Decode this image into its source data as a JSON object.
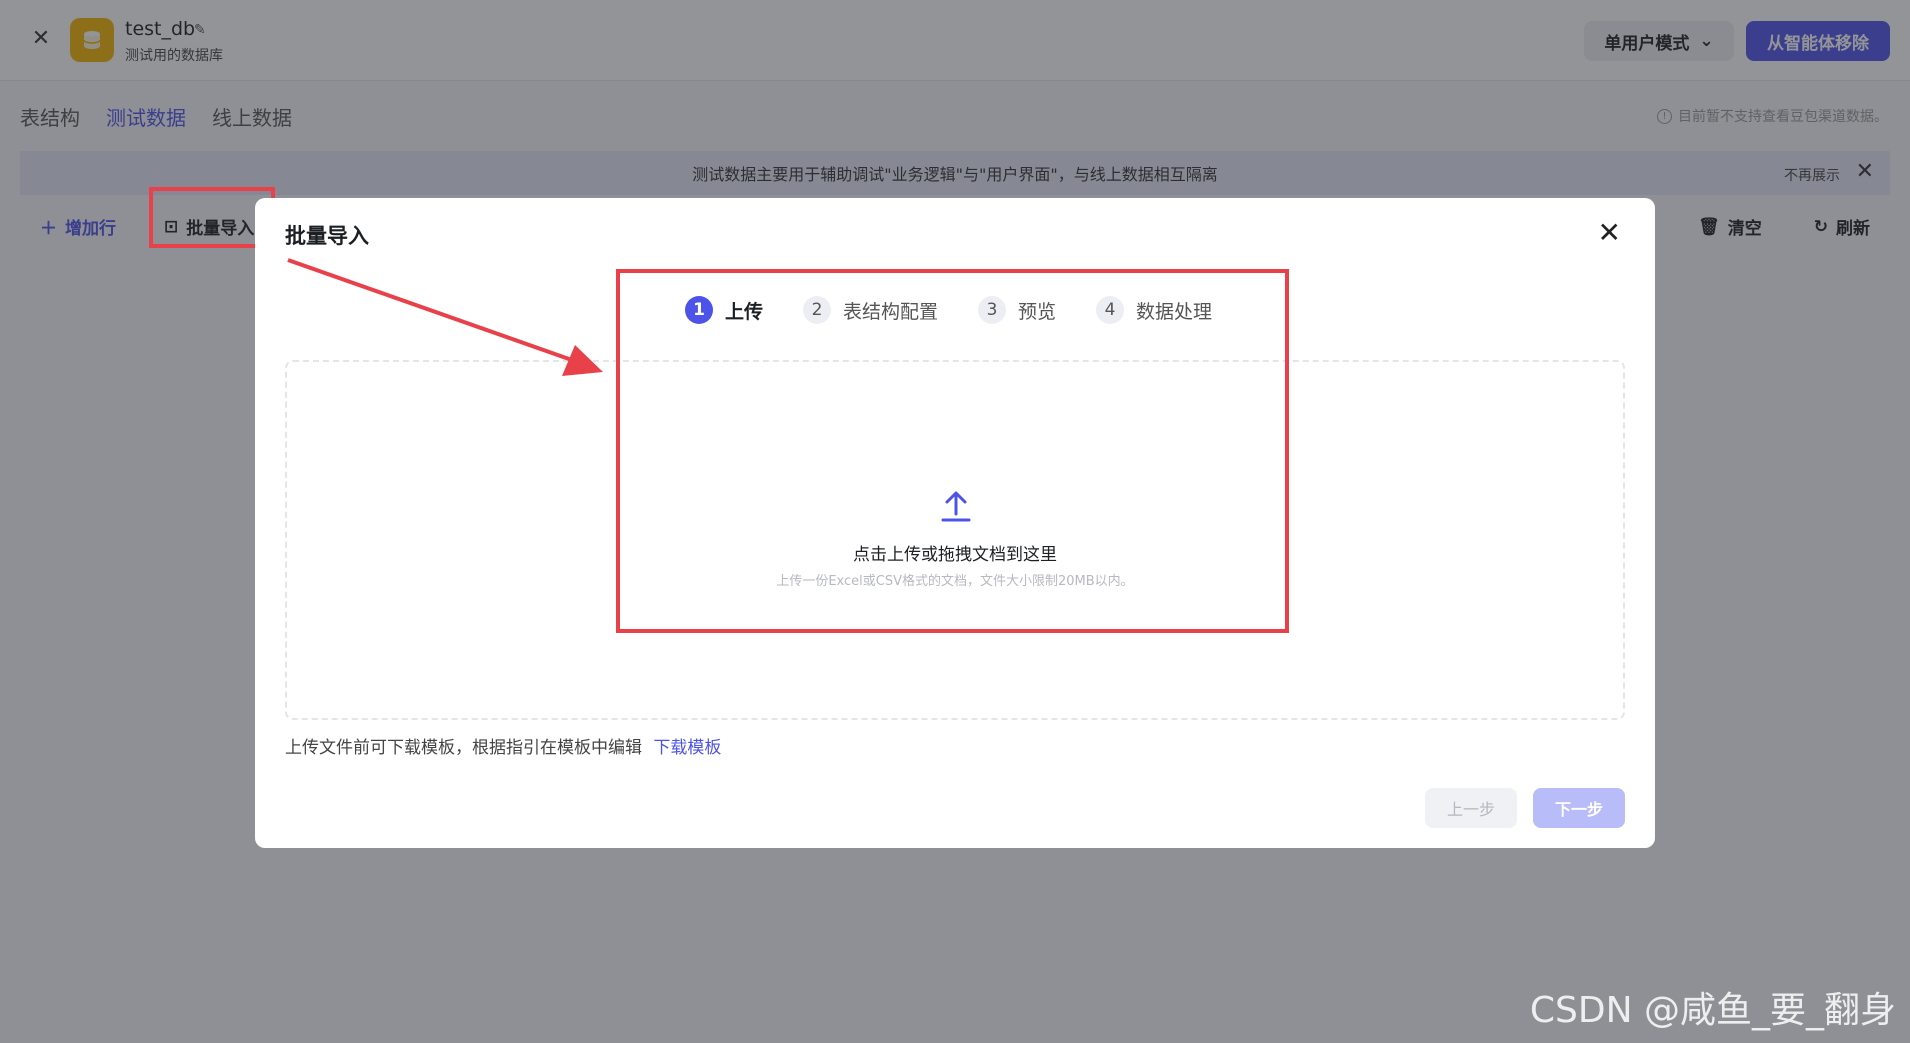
{
  "topbar": {
    "db_name": "test_db",
    "db_desc": "测试用的数据库",
    "mode_label": "单用户模式",
    "remove_label": "从智能体移除"
  },
  "tabs": [
    {
      "label": "表结构"
    },
    {
      "label": "测试数据"
    },
    {
      "label": "线上数据"
    }
  ],
  "note": "目前暂不支持查看豆包渠道数据。",
  "banner": {
    "text": "测试数据主要用于辅助调试\"业务逻辑\"与\"用户界面\"，与线上数据相互隔离",
    "dismiss": "不再展示"
  },
  "toolbar": {
    "add_row": "增加行",
    "batch_import": "批量导入",
    "clear": "清空",
    "refresh": "刷新"
  },
  "modal": {
    "title": "批量导入",
    "steps": [
      {
        "num": "1",
        "label": "上传"
      },
      {
        "num": "2",
        "label": "表结构配置"
      },
      {
        "num": "3",
        "label": "预览"
      },
      {
        "num": "4",
        "label": "数据处理"
      }
    ],
    "drop_main": "点击上传或拖拽文档到这里",
    "drop_sub": "上传一份Excel或CSV格式的文档，文件大小限制20MB以内。",
    "hint": "上传文件前可下载模板，根据指引在模板中编辑",
    "hint_link": "下载模板",
    "prev": "上一步",
    "next": "下一步"
  },
  "watermark": "CSDN @咸鱼_要_翻身",
  "colors": {
    "accent": "#4d53e8",
    "highlight": "#e8414a"
  }
}
